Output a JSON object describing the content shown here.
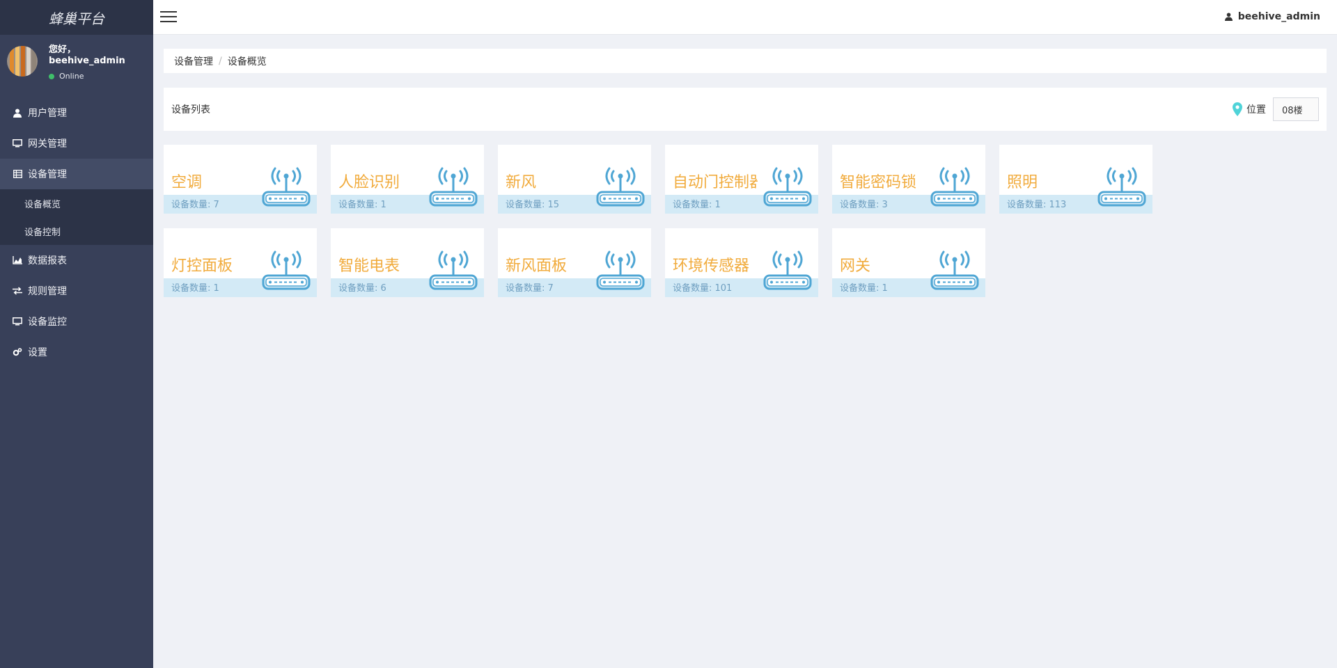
{
  "app": {
    "brand": "蜂巢平台"
  },
  "user": {
    "greeting": "您好，",
    "name": "beehive_admin",
    "status": "Online"
  },
  "sidebar": {
    "items": [
      {
        "label": "用户管理",
        "icon": "user-icon"
      },
      {
        "label": "网关管理",
        "icon": "monitor-icon"
      },
      {
        "label": "设备管理",
        "icon": "table-icon",
        "active": true,
        "children": [
          {
            "label": "设备概览"
          },
          {
            "label": "设备控制"
          }
        ]
      },
      {
        "label": "数据报表",
        "icon": "area-chart-icon"
      },
      {
        "label": "规则管理",
        "icon": "exchange-icon"
      },
      {
        "label": "设备监控",
        "icon": "desktop-icon"
      },
      {
        "label": "设置",
        "icon": "gears-icon"
      }
    ]
  },
  "topbar": {
    "username": "beehive_admin"
  },
  "breadcrumb": {
    "items": [
      "设备管理",
      "设备概览"
    ],
    "separator": "/"
  },
  "panel": {
    "title": "设备列表",
    "location_label": "位置",
    "location_value": "08楼"
  },
  "colors": {
    "accent_orange": "#f1ab3c",
    "band_blue": "#d3eaf6",
    "sidebar": "#384059",
    "status_green": "#3fbf6a"
  },
  "devices": [
    {
      "name": "空调",
      "count_label": "设备数量: 7"
    },
    {
      "name": "人脸识别",
      "count_label": "设备数量: 1"
    },
    {
      "name": "新风",
      "count_label": "设备数量: 15"
    },
    {
      "name": "自动门控制器",
      "count_label": "设备数量: 1"
    },
    {
      "name": "智能密码锁",
      "count_label": "设备数量: 3"
    },
    {
      "name": "照明",
      "count_label": "设备数量: 113"
    },
    {
      "name": "灯控面板",
      "count_label": "设备数量: 1"
    },
    {
      "name": "智能电表",
      "count_label": "设备数量: 6"
    },
    {
      "name": "新风面板",
      "count_label": "设备数量: 7"
    },
    {
      "name": "环境传感器",
      "count_label": "设备数量: 101"
    },
    {
      "name": "网关",
      "count_label": "设备数量: 1"
    }
  ]
}
